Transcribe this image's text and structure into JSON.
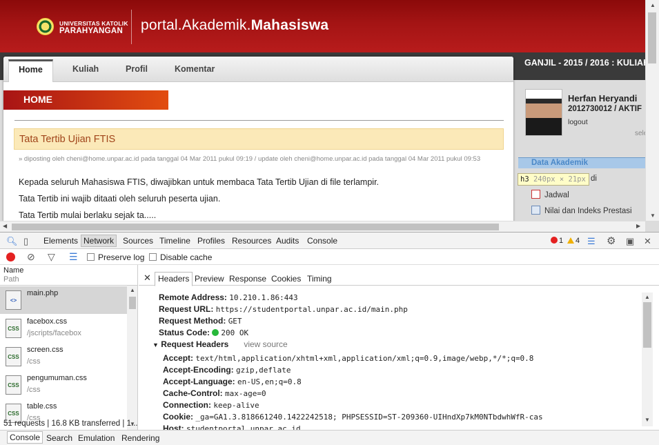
{
  "banner": {
    "logo_line1": "UNIVERSITAS KATOLIK",
    "logo_line2": "PARAHYANGAN",
    "portal_prefix": "portal.Akademik.",
    "portal_bold": "Mahasiswa"
  },
  "nav": {
    "tabs": [
      "Home",
      "Kuliah",
      "Profil",
      "Komentar"
    ],
    "active": "Home"
  },
  "semester": {
    "text": "GANJIL - 2015 / 2016 : ",
    "bold": "KULIAH"
  },
  "main": {
    "section_title": "HOME",
    "announcement_title": "Tata Tertib Ujian FTIS",
    "meta": "» diposting oleh cheni@home.unpar.ac.id pada tanggal 04 Mar 2011 pukul 09:19 / update oleh cheni@home.unpar.ac.id pada tanggal 04 Mar 2011 pukul 09:53",
    "paragraphs": [
      "Kepada seluruh Mahasiswa FTIS, diwajibkan untuk membaca Tata Tertib Ujian di file terlampir.",
      "Tata Tertib ini wajib ditaati oleh seluruh peserta ujian.",
      "Tata Tertib mulai berlaku sejak ta....."
    ]
  },
  "sidebar": {
    "name": "Herfan Heryandi",
    "npm": "2012730012 / AKTIF",
    "logout": "logout",
    "sel": "sele",
    "section": "Data Akademik",
    "tooltip_tag": "h3",
    "tooltip_size": "240px × 21px",
    "partial_item": "di",
    "items": [
      "Jadwal",
      "Nilai dan Indeks Prestasi"
    ]
  },
  "devtools": {
    "tabs": [
      "Elements",
      "Network",
      "Sources",
      "Timeline",
      "Profiles",
      "Resources",
      "Audits",
      "Console"
    ],
    "active_tab": "Network",
    "errors": "1",
    "warnings": "4",
    "preserve_log": "Preserve log",
    "disable_cache": "Disable cache",
    "col_name": "Name",
    "col_path": "Path",
    "requests": [
      {
        "name": "main.php",
        "path": "",
        "type": "html"
      },
      {
        "name": "facebox.css",
        "path": "/jscripts/facebox",
        "type": "css"
      },
      {
        "name": "screen.css",
        "path": "/css",
        "type": "css"
      },
      {
        "name": "pengumuman.css",
        "path": "/css",
        "type": "css"
      },
      {
        "name": "table.css",
        "path": "/css",
        "type": "css"
      }
    ],
    "status_line": "51 requests | 16.8 KB transferred | 1...",
    "detail_tabs": [
      "Headers",
      "Preview",
      "Response",
      "Cookies",
      "Timing"
    ],
    "active_detail_tab": "Headers",
    "general": [
      {
        "key": "Remote Address:",
        "value": "10.210.1.86:443"
      },
      {
        "key": "Request URL:",
        "value": "https://studentportal.unpar.ac.id/main.php"
      },
      {
        "key": "Request Method:",
        "value": "GET"
      },
      {
        "key": "Status Code:",
        "value": "200 OK"
      }
    ],
    "request_headers_label": "Request Headers",
    "view_source": "view source",
    "request_headers": [
      {
        "key": "Accept:",
        "value": "text/html,application/xhtml+xml,application/xml;q=0.9,image/webp,*/*;q=0.8"
      },
      {
        "key": "Accept-Encoding:",
        "value": "gzip,deflate"
      },
      {
        "key": "Accept-Language:",
        "value": "en-US,en;q=0.8"
      },
      {
        "key": "Cache-Control:",
        "value": "max-age=0"
      },
      {
        "key": "Connection:",
        "value": "keep-alive"
      },
      {
        "key": "Cookie:",
        "value": "_ga=GA1.3.818661240.1422242518; PHPSESSID=ST-209360-UIHndXp7kM0NTbdwhWfR-cas"
      },
      {
        "key": "Host:",
        "value": "studentportal.unpar.ac.id"
      }
    ],
    "drawer_tabs": [
      "Console",
      "Search",
      "Emulation",
      "Rendering"
    ],
    "active_drawer_tab": "Console"
  },
  "colors": {
    "banner_red": "#a41414",
    "home_banner_start": "#a81414",
    "home_banner_end": "#e24d10",
    "announcement_bg": "#fbe9b8",
    "record_red": "#e42121",
    "status_green": "#27b83a"
  }
}
